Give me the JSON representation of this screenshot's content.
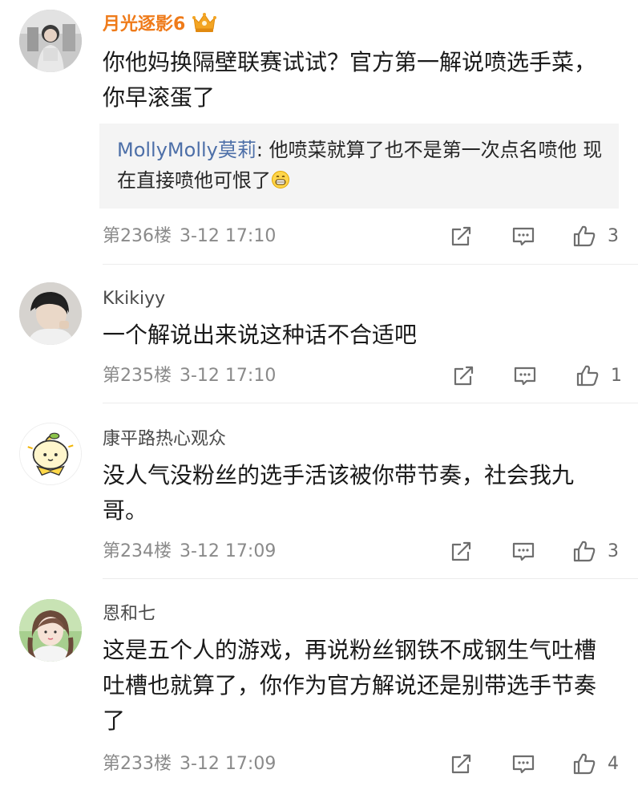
{
  "comments": [
    {
      "username": "月光逐影6",
      "vip_badge": "crown-icon",
      "avatar": "avatar-girl-photo",
      "text": "你他妈换隔壁联赛试试？官方第一解说喷选手菜，你早滚蛋了",
      "quote": {
        "user": "MollyMolly莫莉",
        "text": "他喷菜就算了也不是第一次点名喷他  现在直接喷他可恨了",
        "emoji": "grin-emoji"
      },
      "floor": "第236楼",
      "time": "3-12 17:10",
      "likes": "3"
    },
    {
      "username": "Kkikiyy",
      "avatar": "avatar-boy-photo",
      "text": "一个解说出来说这种话不合适吧",
      "floor": "第235楼",
      "time": "3-12 17:10",
      "likes": "1"
    },
    {
      "username": "康平路热心观众",
      "avatar": "avatar-cartoon-lemon",
      "text": "没人气没粉丝的选手活该被你带节奏，社会我九哥。",
      "floor": "第234楼",
      "time": "3-12 17:09",
      "likes": "3"
    },
    {
      "username": "恩和七",
      "avatar": "avatar-girl-portrait",
      "text": "这是五个人的游戏，再说粉丝钢铁不成钢生气吐槽吐槽也就算了，你作为官方解说还是别带选手节奏了",
      "floor": "第233楼",
      "time": "3-12 17:09",
      "likes": "4"
    }
  ],
  "actions": {
    "share_icon": "share-icon",
    "reply_icon": "comment-icon",
    "like_icon": "like-icon"
  },
  "colors": {
    "vip_name": "#ef7b1a",
    "quote_user": "#4d6fa8",
    "meta": "#8a8a8a",
    "quote_bg": "#f4f4f4"
  }
}
